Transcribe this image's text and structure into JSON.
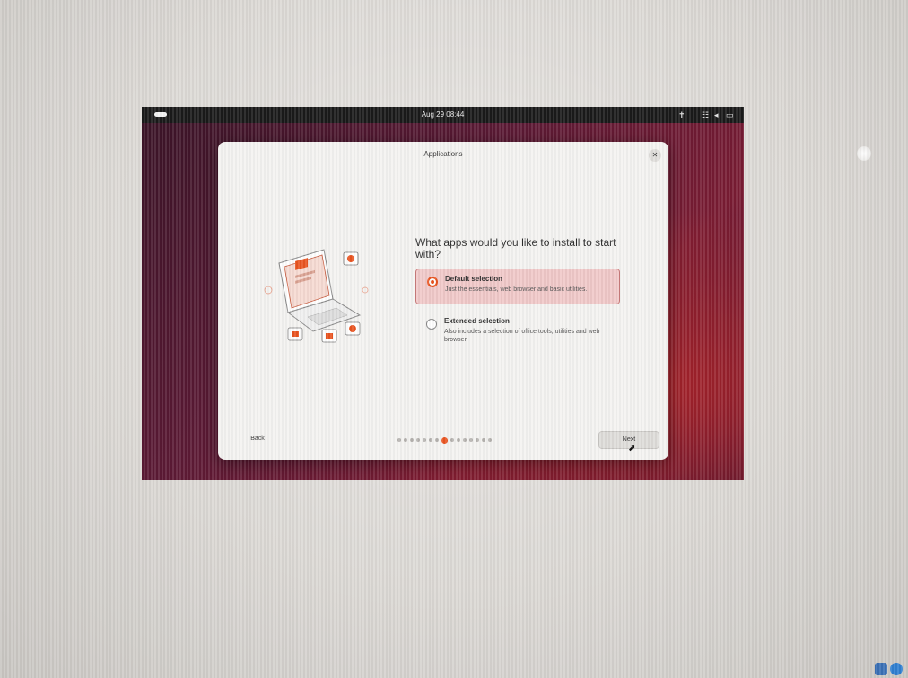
{
  "topbar": {
    "clock": "Aug 29 08:44"
  },
  "dialog": {
    "title": "Applications",
    "question": "What apps would you like to install to start with?",
    "options": [
      {
        "title": "Default selection",
        "description": "Just the essentials, web browser and basic utilities.",
        "selected": true
      },
      {
        "title": "Extended selection",
        "description": "Also includes a selection of office tools, utilities and web browser.",
        "selected": false
      }
    ],
    "back_label": "Back",
    "next_label": "Next",
    "progress": {
      "total_steps": 15,
      "current_step": 7
    }
  },
  "icons": {
    "activities": "activities-pill-icon",
    "accessibility": "accessibility-icon",
    "network": "network-icon",
    "sound": "speaker-icon",
    "power": "battery-icon",
    "close": "close-icon"
  },
  "colors": {
    "accent": "#e95420",
    "selection_bg": "#f0c8c8",
    "desktop": "#5c1a35"
  }
}
